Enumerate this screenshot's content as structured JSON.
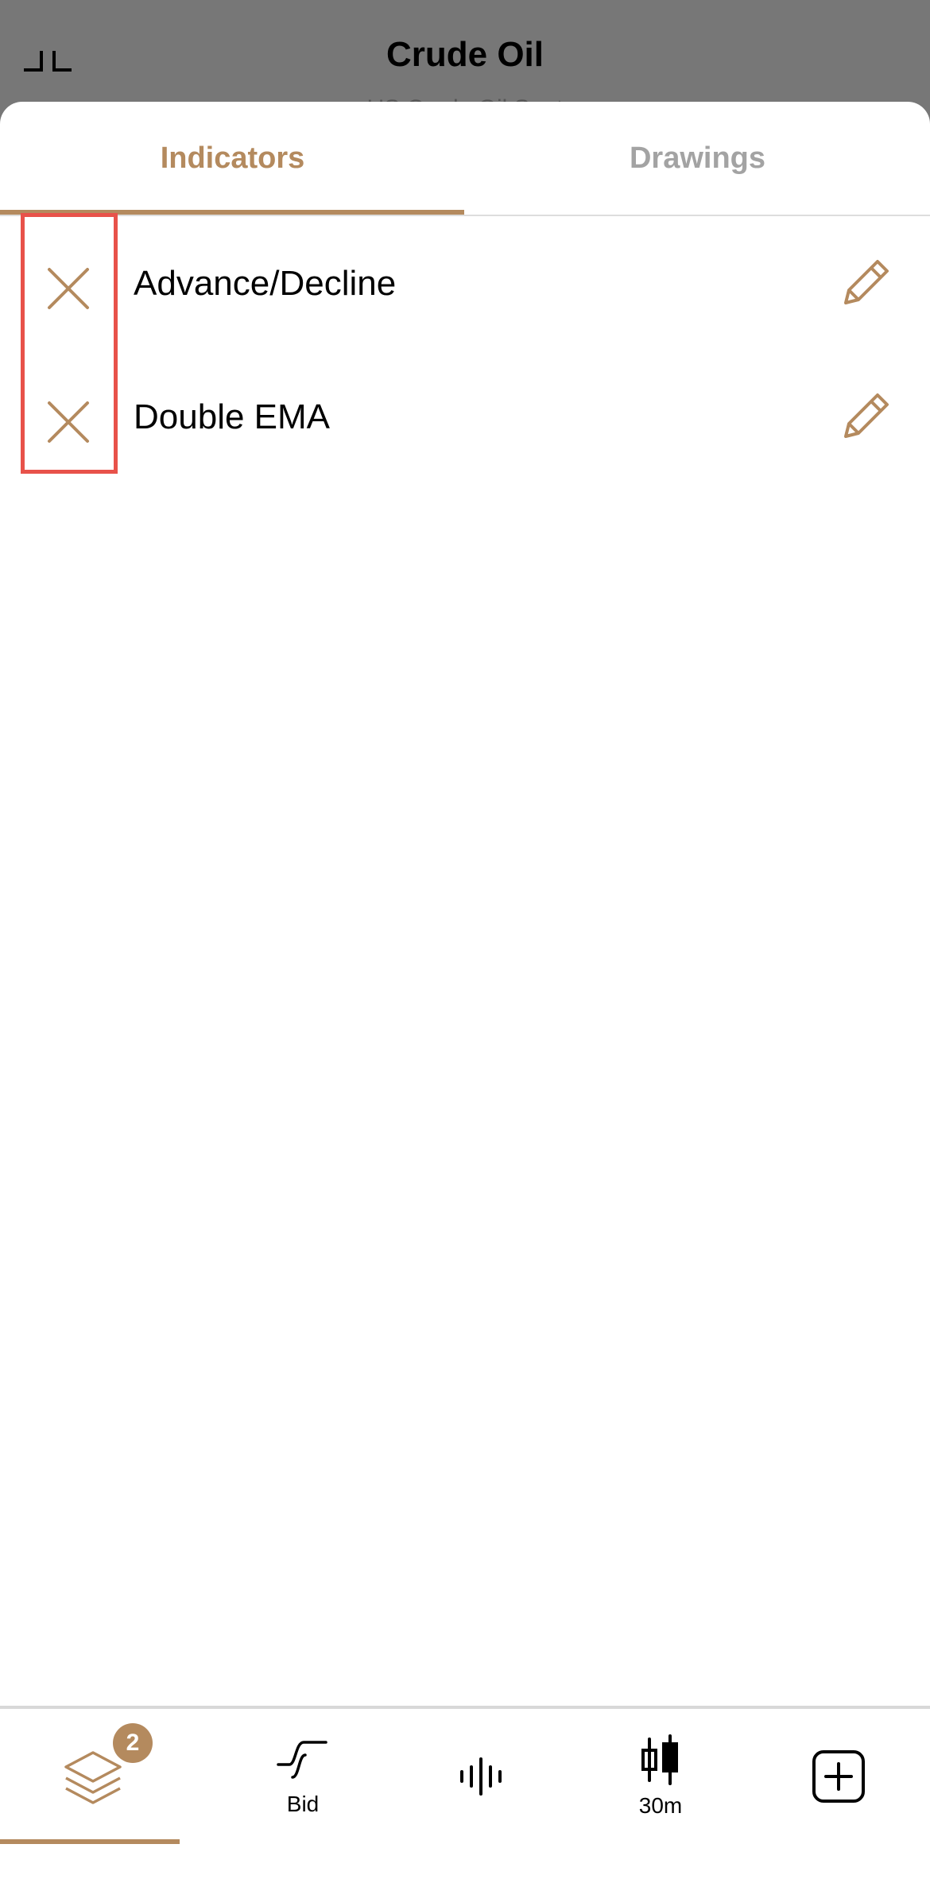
{
  "header": {
    "title": "Crude Oil",
    "subtitle": "US Crude Oil Spot"
  },
  "tabs": [
    {
      "label": "Indicators",
      "active": true
    },
    {
      "label": "Drawings",
      "active": false
    }
  ],
  "indicators": [
    {
      "label": "Advance/Decline"
    },
    {
      "label": "Double EMA"
    }
  ],
  "bottom_bar": {
    "layers_badge": "2",
    "price_type_label": "Bid",
    "interval_label": "30m"
  },
  "colors": {
    "accent": "#b48a5e",
    "highlight": "#e8524a",
    "inactive_tab": "#a3a3a3"
  }
}
